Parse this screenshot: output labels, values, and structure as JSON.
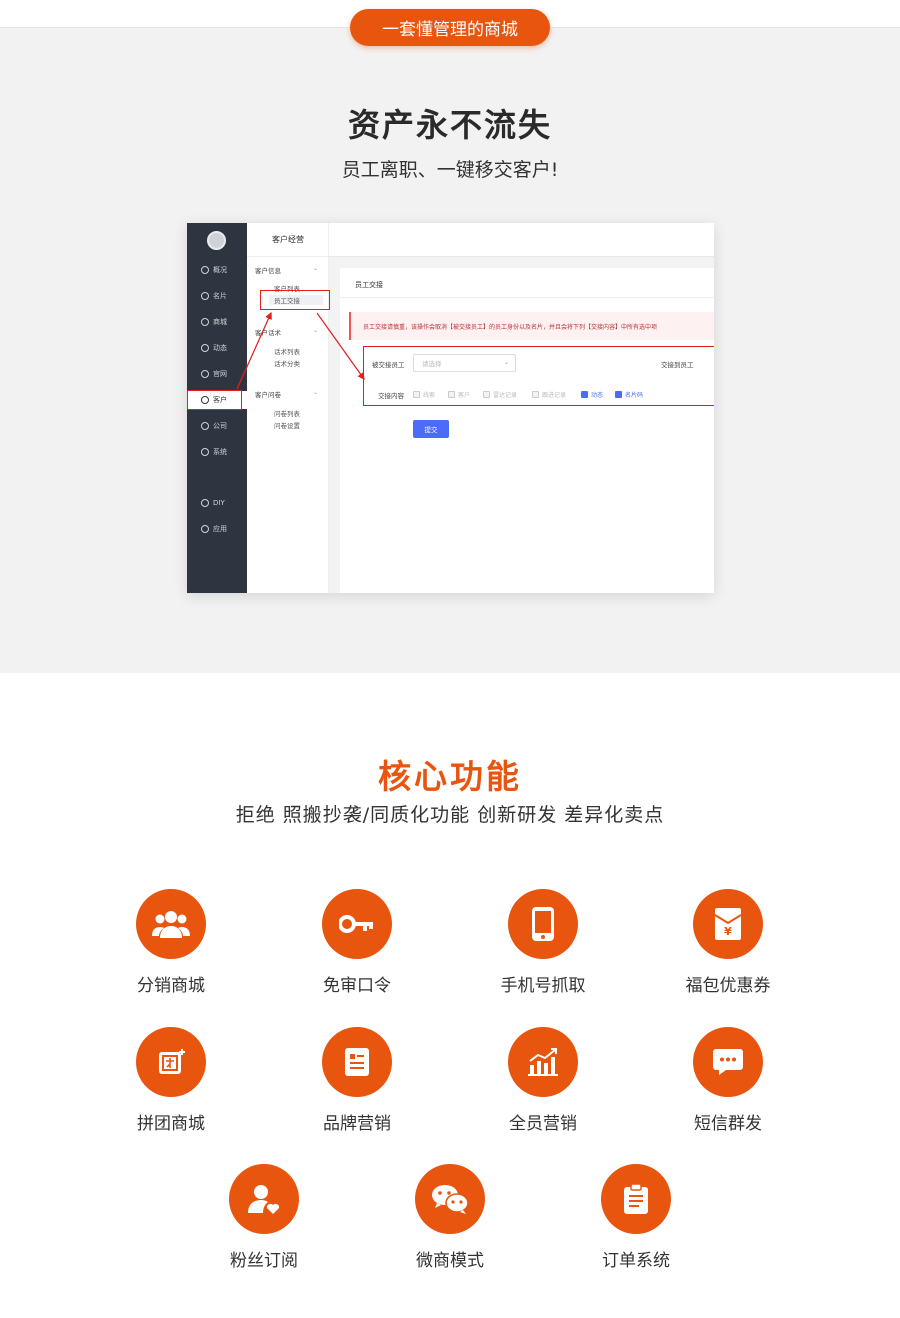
{
  "top_badge": "一套懂管理的商城",
  "hero": {
    "title": "资产永不流失",
    "subtitle": "员工离职、一键移交客户!"
  },
  "mockup": {
    "sidebar": [
      {
        "label": "概况",
        "icon": "chart-icon"
      },
      {
        "label": "名片",
        "icon": "card-icon"
      },
      {
        "label": "商城",
        "icon": "shop-icon"
      },
      {
        "label": "动态",
        "icon": "compass-icon"
      },
      {
        "label": "官网",
        "icon": "globe-icon"
      },
      {
        "label": "客户",
        "icon": "user-icon"
      },
      {
        "label": "公司",
        "icon": "org-icon"
      },
      {
        "label": "系统",
        "icon": "gear-icon"
      },
      {
        "label": "DIY",
        "icon": "diy-icon"
      },
      {
        "label": "应用",
        "icon": "apps-icon"
      }
    ],
    "submenu": {
      "header": "客户经营",
      "groups": [
        {
          "title": "客户信息",
          "items": [
            "客户列表",
            "员工交接"
          ]
        },
        {
          "title": "客户话术",
          "items": [
            "话术列表",
            "话术分类"
          ]
        },
        {
          "title": "客户问卷",
          "items": [
            "问卷列表",
            "问卷设置"
          ]
        }
      ]
    },
    "panel": {
      "title": "员工交接",
      "notice": "员工交接请慎重，该操作会取消【被交接员工】的员工身份以及名片，并且会将下列【交接内容】中所有选中项",
      "from_label": "被交接员工",
      "from_placeholder": "请选择",
      "to_label": "交接到员工",
      "content_label": "交接内容",
      "checkboxes": [
        {
          "label": "线索",
          "checked": false
        },
        {
          "label": "客户",
          "checked": false
        },
        {
          "label": "雷达记录",
          "checked": false
        },
        {
          "label": "跟进记录",
          "checked": false
        },
        {
          "label": "动态",
          "checked": true
        },
        {
          "label": "名片码",
          "checked": true
        }
      ],
      "submit_label": "提交"
    }
  },
  "features": {
    "title": "核心功能",
    "subtitle": "拒绝 照搬抄袭/同质化功能 创新研发 差异化卖点",
    "items": [
      {
        "label": "分销商城",
        "icon": "users-icon"
      },
      {
        "label": "免审口令",
        "icon": "key-icon"
      },
      {
        "label": "手机号抓取",
        "icon": "phone-icon"
      },
      {
        "label": "福包优惠券",
        "icon": "red-envelope-icon"
      },
      {
        "label": "拼团商城",
        "icon": "group-icon"
      },
      {
        "label": "品牌营销",
        "icon": "document-icon"
      },
      {
        "label": "全员营销",
        "icon": "growth-chart-icon"
      },
      {
        "label": "短信群发",
        "icon": "chat-icon"
      },
      {
        "label": "粉丝订阅",
        "icon": "fan-heart-icon"
      },
      {
        "label": "微商模式",
        "icon": "wechat-icon"
      },
      {
        "label": "订单系统",
        "icon": "clipboard-icon"
      }
    ]
  },
  "colors": {
    "accent": "#e8550e",
    "sidebar": "#2f3540",
    "highlight": "#e21e1e",
    "primary_btn": "#4a6cf7"
  }
}
